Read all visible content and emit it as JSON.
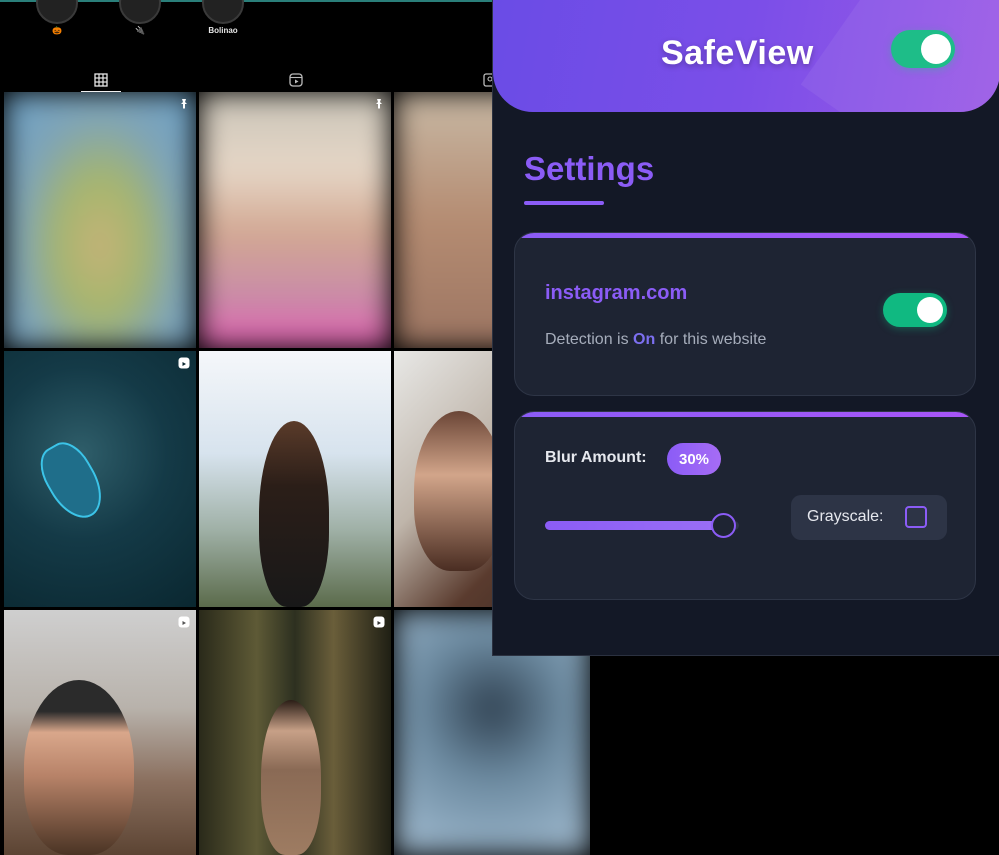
{
  "instagram": {
    "highlights": [
      {
        "label": "🎃"
      },
      {
        "label": "🔌"
      },
      {
        "label": "Bolinao"
      }
    ],
    "tabs": [
      {
        "icon": "grid-icon",
        "active": true
      },
      {
        "icon": "reels-icon",
        "active": false
      },
      {
        "icon": "tagged-icon",
        "active": false
      }
    ]
  },
  "popup": {
    "app_title": "SafeView",
    "global_toggle_on": true,
    "settings_title": "Settings",
    "site_card": {
      "site": "instagram.com",
      "detection_prefix": "Detection is",
      "detection_state": "On",
      "detection_suffix": "for this website",
      "toggle_on": true
    },
    "blur_card": {
      "blur_label": "Blur Amount:",
      "blur_value": "30%",
      "slider_fraction": 0.92,
      "grayscale_label": "Grayscale:",
      "grayscale_checked": false
    }
  },
  "colors": {
    "accent": "#8b5cf6",
    "toggle_on": "#10b981",
    "popup_bg": "#131826",
    "card_bg": "#1e2433"
  }
}
